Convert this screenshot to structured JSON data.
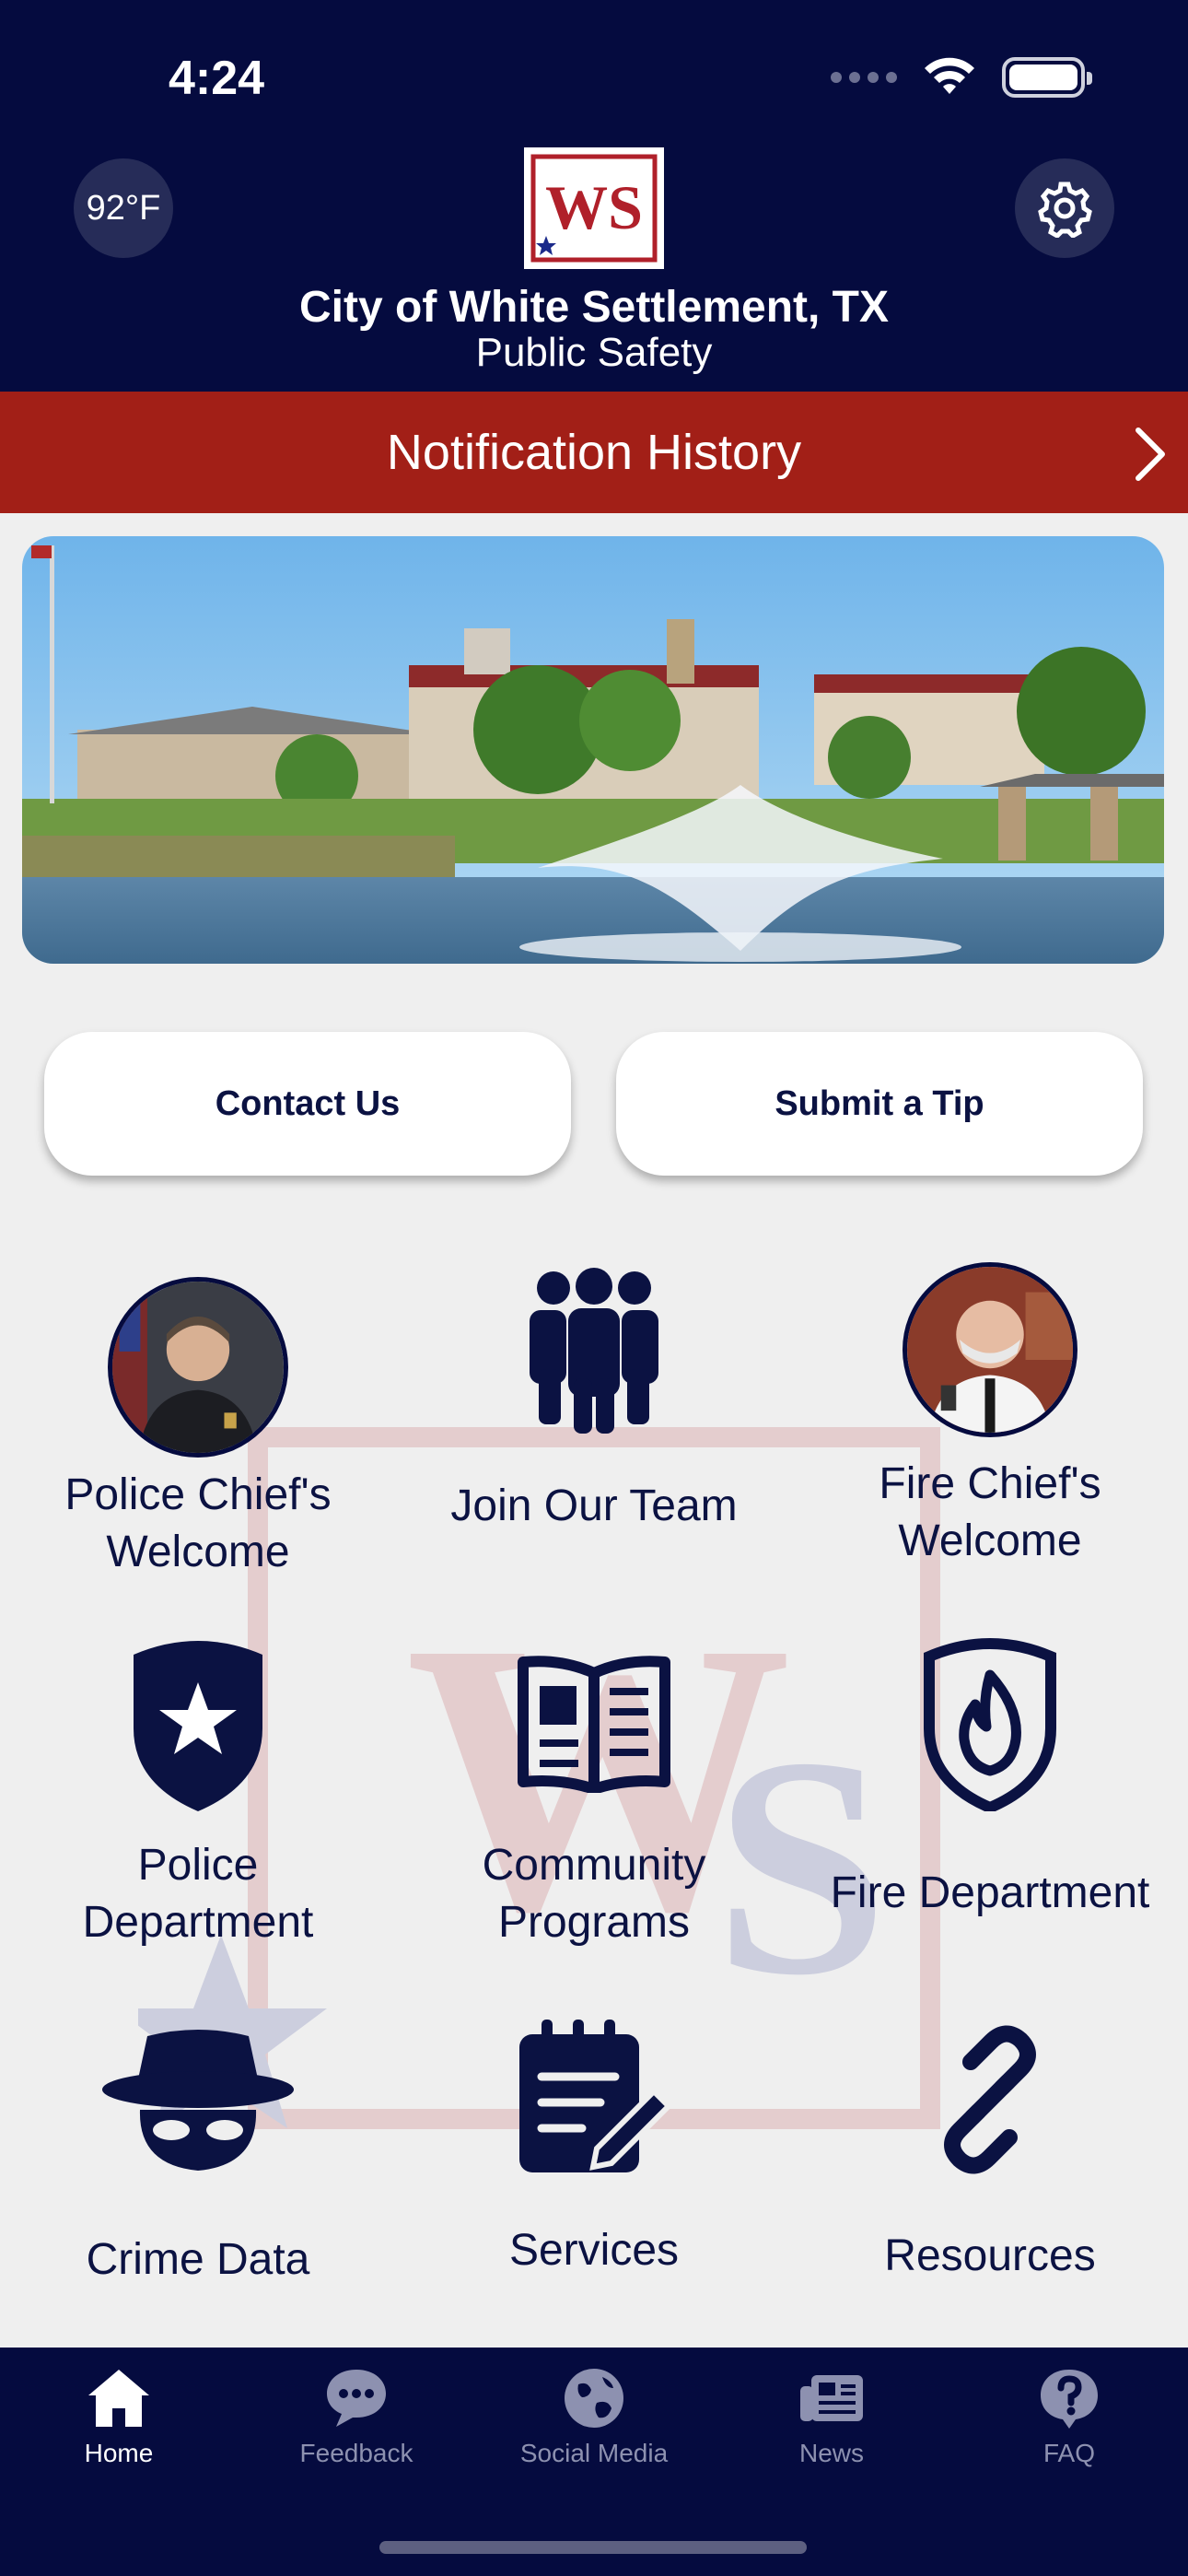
{
  "status_bar": {
    "time": "4:24"
  },
  "header": {
    "temperature": "92°F",
    "logo_text": "WS",
    "title": "City of White Settlement, TX",
    "subtitle": "Public Safety"
  },
  "notification_bar": {
    "label": "Notification History"
  },
  "actions": {
    "contact": "Contact Us",
    "tip": "Submit a Tip"
  },
  "grid": [
    {
      "label_line1": "Police Chief's",
      "label_line2": "Welcome",
      "icon": "police-chief-photo"
    },
    {
      "label_line1": "Join Our Team",
      "label_line2": "",
      "icon": "people-icon"
    },
    {
      "label_line1": "Fire Chief's",
      "label_line2": "Welcome",
      "icon": "fire-chief-photo"
    },
    {
      "label_line1": "Police",
      "label_line2": "Department",
      "icon": "police-badge-icon"
    },
    {
      "label_line1": "Community",
      "label_line2": "Programs",
      "icon": "open-book-icon"
    },
    {
      "label_line1": "Fire Department",
      "label_line2": "",
      "icon": "fire-shield-icon"
    },
    {
      "label_line1": "Crime Data",
      "label_line2": "",
      "icon": "masked-bandit-icon"
    },
    {
      "label_line1": "Services",
      "label_line2": "",
      "icon": "notepad-pencil-icon"
    },
    {
      "label_line1": "Resources",
      "label_line2": "",
      "icon": "link-icon"
    }
  ],
  "tabs": [
    {
      "label": "Home",
      "icon": "home-icon",
      "active": true
    },
    {
      "label": "Feedback",
      "icon": "chat-bubble-icon",
      "active": false
    },
    {
      "label": "Social Media",
      "icon": "globe-icon",
      "active": false
    },
    {
      "label": "News",
      "icon": "newspaper-icon",
      "active": false
    },
    {
      "label": "FAQ",
      "icon": "question-icon",
      "active": false
    }
  ],
  "colors": {
    "navy": "#050b3f",
    "red_bar": "#a21f17",
    "icon_navy": "#0b1242",
    "background": "#efefef"
  }
}
